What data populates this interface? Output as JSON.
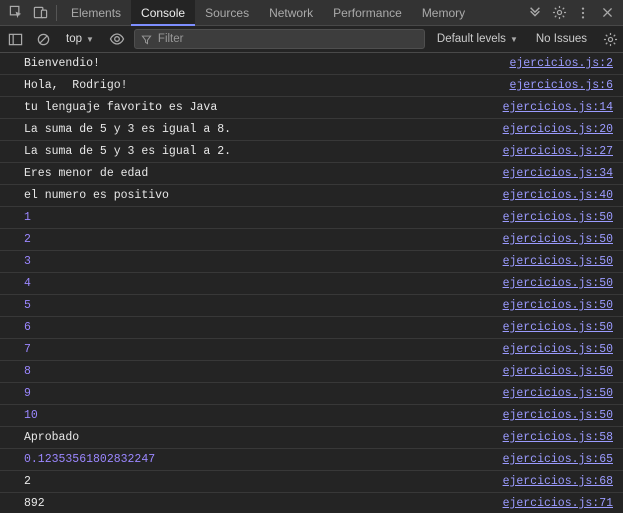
{
  "tabs": {
    "items": [
      "Elements",
      "Console",
      "Sources",
      "Network",
      "Performance",
      "Memory"
    ],
    "activeIndex": 1
  },
  "toolbar": {
    "context": "top",
    "filter_placeholder": "Filter",
    "levels_label": "Default levels",
    "issues_label": "No Issues"
  },
  "console": {
    "rows": [
      {
        "msg": "Bienvendio!",
        "type": "text",
        "src": "ejercicios.js:2"
      },
      {
        "msg": "Hola,  Rodrigo!",
        "type": "text",
        "src": "ejercicios.js:6"
      },
      {
        "msg": "tu lenguaje favorito es Java",
        "type": "text",
        "src": "ejercicios.js:14"
      },
      {
        "msg": "La suma de 5 y 3 es igual a 8.",
        "type": "text",
        "src": "ejercicios.js:20"
      },
      {
        "msg": "La suma de 5 y 3 es igual a 2.",
        "type": "text",
        "src": "ejercicios.js:27"
      },
      {
        "msg": "Eres menor de edad",
        "type": "text",
        "src": "ejercicios.js:34"
      },
      {
        "msg": "el numero es positivo",
        "type": "text",
        "src": "ejercicios.js:40"
      },
      {
        "msg": "1",
        "type": "number",
        "src": "ejercicios.js:50"
      },
      {
        "msg": "2",
        "type": "number",
        "src": "ejercicios.js:50"
      },
      {
        "msg": "3",
        "type": "number",
        "src": "ejercicios.js:50"
      },
      {
        "msg": "4",
        "type": "number",
        "src": "ejercicios.js:50"
      },
      {
        "msg": "5",
        "type": "number",
        "src": "ejercicios.js:50"
      },
      {
        "msg": "6",
        "type": "number",
        "src": "ejercicios.js:50"
      },
      {
        "msg": "7",
        "type": "number",
        "src": "ejercicios.js:50"
      },
      {
        "msg": "8",
        "type": "number",
        "src": "ejercicios.js:50"
      },
      {
        "msg": "9",
        "type": "number",
        "src": "ejercicios.js:50"
      },
      {
        "msg": "10",
        "type": "number",
        "src": "ejercicios.js:50"
      },
      {
        "msg": "Aprobado",
        "type": "text",
        "src": "ejercicios.js:58"
      },
      {
        "msg": "0.12353561802832247",
        "type": "number",
        "src": "ejercicios.js:65"
      },
      {
        "msg": "2",
        "type": "text",
        "src": "ejercicios.js:68"
      },
      {
        "msg": "892",
        "type": "text",
        "src": "ejercicios.js:71"
      }
    ]
  }
}
